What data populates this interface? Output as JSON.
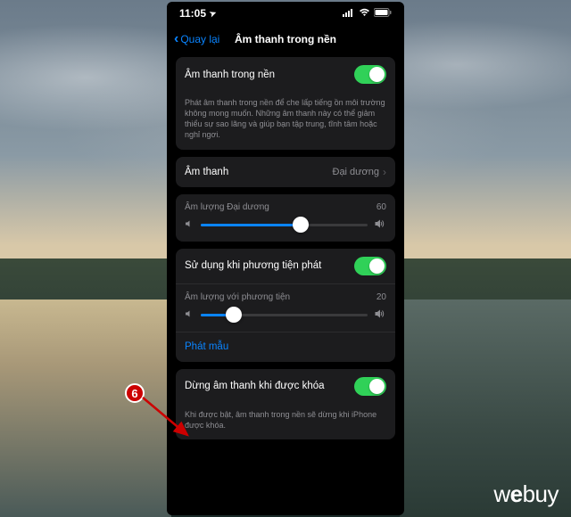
{
  "status": {
    "time": "11:05",
    "location_icon": "➤"
  },
  "nav": {
    "back_label": "Quay lại",
    "title": "Âm thanh trong nền"
  },
  "section1": {
    "label": "Âm thanh trong nền",
    "footer": "Phát âm thanh trong nền để che lấp tiếng ồn môi trường không mong muốn. Những âm thanh này có thể giảm thiểu sự sao lãng và giúp bạn tập trung, tĩnh tâm hoặc nghỉ ngơi."
  },
  "section2": {
    "label": "Âm thanh",
    "value": "Đại dương"
  },
  "section3": {
    "slider_label": "Âm lượng Đại dương",
    "slider_value": "60"
  },
  "section4": {
    "toggle_label": "Sử dụng khi phương tiện phát",
    "slider_label": "Âm lượng với phương tiện",
    "slider_value": "20",
    "sample_label": "Phát mẫu"
  },
  "section5": {
    "label": "Dừng âm thanh khi được khóa",
    "footer": "Khi được bật, âm thanh trong nền sẽ dừng khi iPhone được khóa."
  },
  "annotation": {
    "number": "6"
  },
  "watermark": {
    "text_w": "w",
    "text_e": "e",
    "text_buy": "buy"
  }
}
